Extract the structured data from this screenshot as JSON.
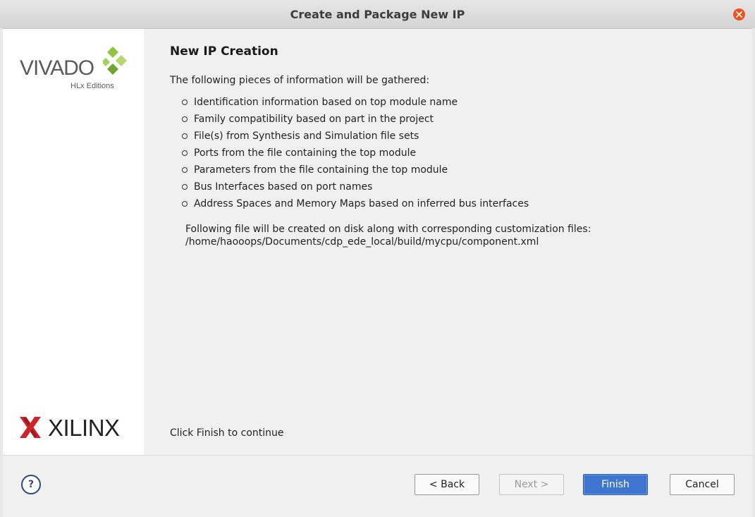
{
  "window": {
    "title": "Create and Package New IP"
  },
  "sidebar": {
    "vivado_logo_text": "VIVADO",
    "vivado_logo_sub": "HLx Editions",
    "xilinx_logo_text": "XILINX"
  },
  "main": {
    "heading": "New IP Creation",
    "intro": "The following pieces of information will be gathered:",
    "bullets": [
      "Identification information based on top module name",
      "Family compatibility based on part in the project",
      "File(s) from Synthesis and Simulation file sets",
      "Ports from the file containing the top module",
      "Parameters from the file containing the top module",
      "Bus Interfaces based on port names",
      "Address Spaces and Memory Maps based on inferred bus interfaces"
    ],
    "file_note_line1": "Following file will be created on disk along with corresponding customization files:",
    "file_note_line2": "/home/haooops/Documents/cdp_ede_local/build/mycpu/component.xml",
    "continue_text": "Click Finish to continue"
  },
  "footer": {
    "help_label": "?",
    "back_label": "< Back",
    "next_label": "Next >",
    "finish_label": "Finish",
    "cancel_label": "Cancel"
  },
  "colors": {
    "accent": "#3e76cf",
    "close": "#e95420",
    "vivado_green": "#8dc63f"
  }
}
